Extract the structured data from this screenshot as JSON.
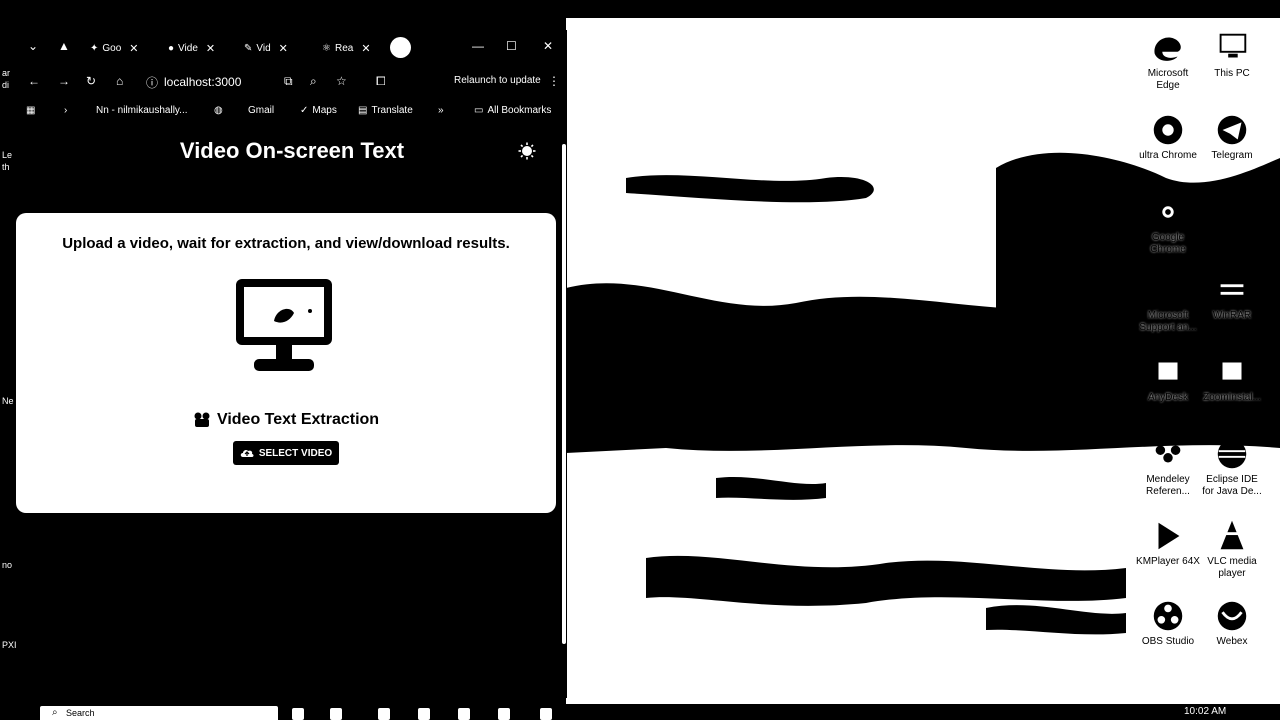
{
  "desktop": {
    "left_strip": [
      "ar",
      "di",
      "Le",
      "th",
      "Ne",
      "no",
      "PXI"
    ],
    "icons": [
      {
        "name": "microsoft-edge-icon",
        "label": "Microsoft Edge"
      },
      {
        "name": "this-pc-icon",
        "label": "This PC"
      },
      {
        "name": "chrome-icon",
        "label": "ultra Chrome"
      },
      {
        "name": "telegram-icon",
        "label": "Telegram"
      },
      {
        "name": "google-chrome-icon",
        "label": "Google Chrome"
      },
      {
        "name": "ms-support-icon",
        "label": "Microsoft Support an..."
      },
      {
        "name": "winrar-icon",
        "label": "WinRAR"
      },
      {
        "name": "anydesk-icon",
        "label": "AnyDesk"
      },
      {
        "name": "zoom-installer-icon",
        "label": "ZoomInstal..."
      },
      {
        "name": "mendeley-icon",
        "label": "Mendeley Referen..."
      },
      {
        "name": "eclipse-icon",
        "label": "Eclipse IDE for Java De..."
      },
      {
        "name": "kmplayer-icon",
        "label": "KMPlayer 64X"
      },
      {
        "name": "vlc-icon",
        "label": "VLC media player"
      },
      {
        "name": "obs-icon",
        "label": "OBS Studio"
      },
      {
        "name": "webex-icon",
        "label": "Webex"
      }
    ]
  },
  "browser": {
    "tabs": [
      {
        "label": "Goo"
      },
      {
        "label": "Vide"
      },
      {
        "label": "Vid"
      },
      {
        "label": "Rea"
      }
    ],
    "url": "localhost:3000",
    "relaunch": "Relaunch to update",
    "bookmarks": {
      "nn": "Nn - nilmikaushally...",
      "gmail": "Gmail",
      "maps": "Maps",
      "translate": "Translate",
      "more": "»",
      "all": "All Bookmarks"
    }
  },
  "page": {
    "title": "Video On-screen Text",
    "description": "Upload a video, wait for extraction, and view/download results.",
    "extract_heading": "Video Text Extraction",
    "select_button": "SELECT VIDEO"
  },
  "taskbar": {
    "search_placeholder": "Search",
    "time": "10:02 AM"
  },
  "colors": {
    "page_bg": "#000000",
    "card_bg": "#ffffff",
    "text_light": "#ffffff",
    "text_dark": "#000000"
  }
}
